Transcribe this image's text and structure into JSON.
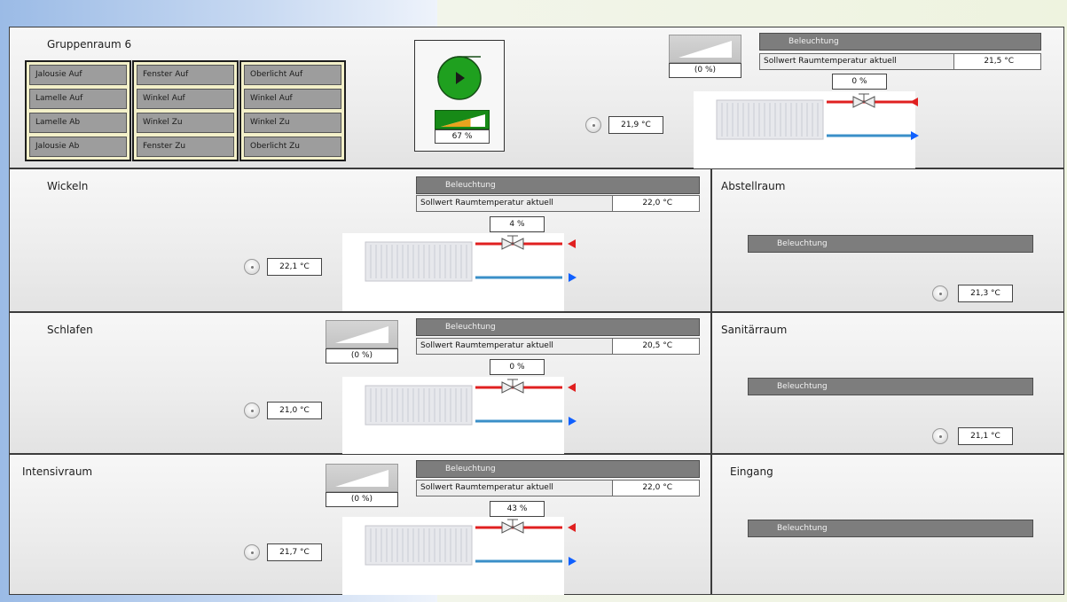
{
  "labels": {
    "beleuchtung": "Beleuchtung",
    "sollwert": "Sollwert Raumtemperatur aktuell"
  },
  "colors": {
    "pump_green": "#1fa01f",
    "supply_red": "#e02020",
    "return_blue": "#1060ff",
    "panel_border": "#3c3c3c",
    "button_gray": "#9d9d9d",
    "button_frame": "#f3f0c9"
  },
  "gruppenraum": {
    "title": "Gruppenraum 6",
    "jalousie_buttons": [
      "Jalousie Auf",
      "Lamelle Auf",
      "Lamelle Ab",
      "Jalousie Ab"
    ],
    "fenster_buttons": [
      "Fenster Auf",
      "Winkel Auf",
      "Winkel Zu",
      "Fenster Zu"
    ],
    "oberlicht_buttons": [
      "Oberlicht Auf",
      "Winkel Auf",
      "Winkel Zu",
      "Oberlicht Zu"
    ],
    "pump_icon": "pump-icon",
    "pump_percent": "67 %",
    "pump_level": 0.67,
    "dimmer_percent": "(0 %)",
    "setpoint": "21,5 °C",
    "valve_percent": "0 %",
    "room_temp": "21,9 °C"
  },
  "wickeln": {
    "title": "Wickeln",
    "setpoint": "22,0 °C",
    "valve_percent": "4 %",
    "room_temp": "22,1 °C"
  },
  "schlafen": {
    "title": "Schlafen",
    "dimmer_percent": "(0 %)",
    "setpoint": "20,5 °C",
    "valve_percent": "0 %",
    "room_temp": "21,0 °C"
  },
  "intensivraum": {
    "title": "Intensivraum",
    "dimmer_percent": "(0 %)",
    "setpoint": "22,0 °C",
    "valve_percent": "43 %",
    "room_temp": "21,7 °C"
  },
  "abstellraum": {
    "title": "Abstellraum",
    "room_temp": "21,3 °C"
  },
  "sanitaerraum": {
    "title": "Sanitärraum",
    "room_temp": "21,1 °C"
  },
  "eingang": {
    "title": "Eingang"
  }
}
